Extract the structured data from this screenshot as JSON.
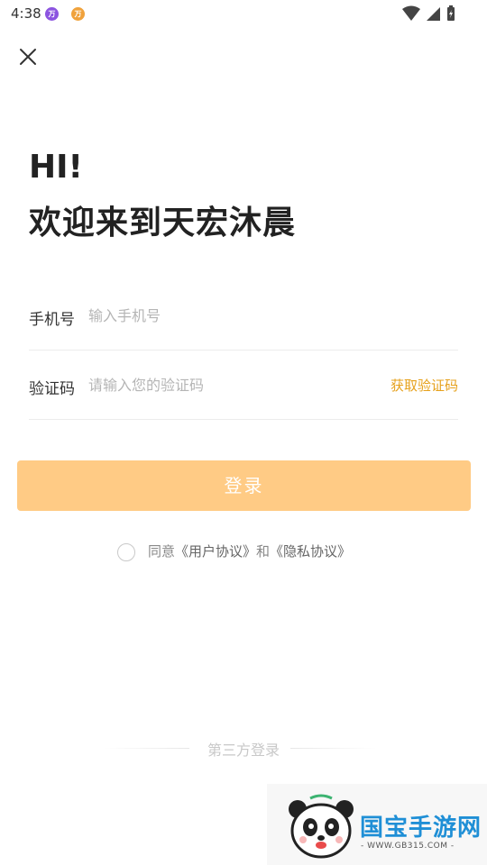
{
  "status_bar": {
    "time": "4:38",
    "badge_1": "万",
    "badge_2": "万"
  },
  "greeting": {
    "line1": "HI!",
    "line2": "欢迎来到天宏沐晨"
  },
  "form": {
    "phone_label": "手机号",
    "phone_placeholder": "输入手机号",
    "phone_value": "",
    "code_label": "验证码",
    "code_placeholder": "请输入您的验证码",
    "code_value": "",
    "get_code_label": "获取验证码"
  },
  "login_button": "登录",
  "agreement": {
    "prefix": "同意",
    "user_agreement": "《用户协议》",
    "conjunction": "和",
    "privacy_policy": "《隐私协议》",
    "checked": false
  },
  "third_party_label": "第三方登录",
  "watermark": {
    "title": "国宝手游网",
    "url": "- WWW.GB315.COM -"
  },
  "colors": {
    "accent": "#e6a11c",
    "button": "#ffcb85",
    "watermark_blue": "#1f8fd6"
  }
}
